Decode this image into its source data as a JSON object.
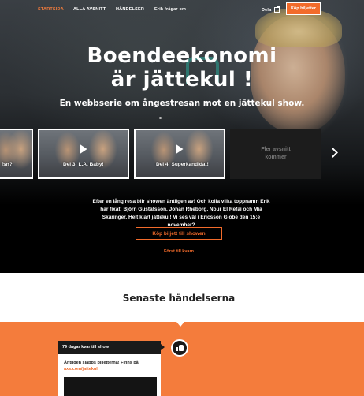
{
  "nav": {
    "items": [
      {
        "label": "STARTSIDA",
        "active": true
      },
      {
        "label": "ALLA AVSNITT",
        "active": false
      },
      {
        "label": "HÄNDELSER",
        "active": false
      },
      {
        "label": "Erik frågar om",
        "active": false
      }
    ],
    "share_label": "Dela",
    "buy_label": "Köp biljetter"
  },
  "hero": {
    "title_line1": "Boendeekonomi",
    "title_line2": "är jättekul !",
    "subtitle": "En webbserie om ångestresan mot en jättekul show."
  },
  "episodes": [
    {
      "label": "fsn?"
    },
    {
      "label": "Del 3: L.A. Baby!"
    },
    {
      "label": "Del 4: Superkandidat!"
    }
  ],
  "more_episodes": "Fler avsnitt kommer",
  "intro_text": "Efter en lång resa blir showen äntligen av! Och kolla vilka toppnamn Erik har fixat: Björn Gustafsson, Johan Rheborg, Nour El Refai och Mia Skäringer. Helt klart jättekul! Vi ses väl i Ericsson Globe den 15:e november?",
  "buy_show_label": "Köp biljett till showen",
  "first_link": "Först till kvarn",
  "events": {
    "title": "Senaste händelserna",
    "card": {
      "header": "79 dagar kvar till show",
      "text": "Äntligen släpps biljetterna! Finns på",
      "link": "axs.com/jattekul"
    }
  },
  "colors": {
    "accent": "#f26b2b",
    "timeline": "#f47c3c"
  },
  "icons": [
    "share-icon",
    "play-icon",
    "chevron-right-icon",
    "thumbs-up-icon"
  ]
}
